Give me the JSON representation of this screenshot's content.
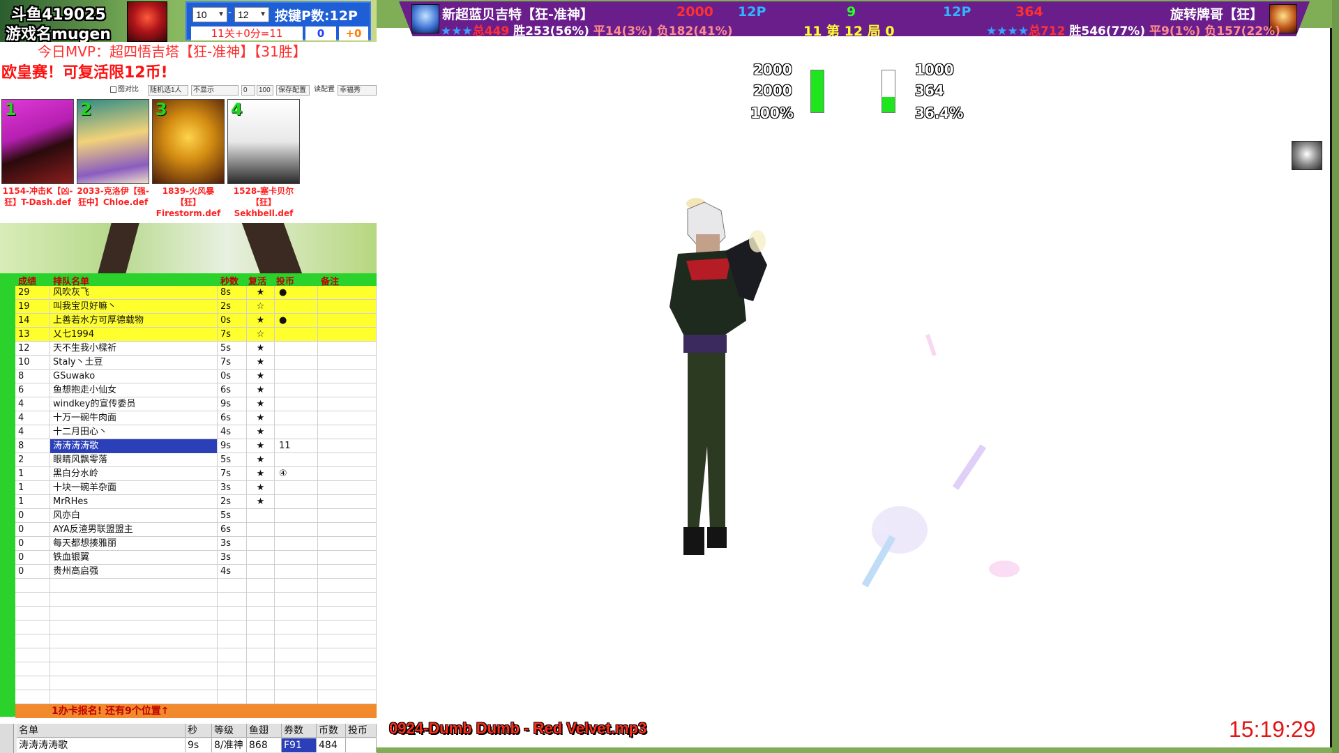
{
  "header": {
    "room_id": "斗鱼419025",
    "game_name": "游戏名mugen",
    "select_a": "10",
    "select_b": "12",
    "keypress_label": "按键P数:12P",
    "level_info": "11关+0分=11",
    "score_a": "0",
    "score_b": "+0"
  },
  "mvp_text": "今日MVP：超四悟吉塔【狂-准神】【31胜】",
  "promo_text": "欧皇赛！可复活限12币!",
  "options": {
    "compare_label": "图对比",
    "random_select": "随机选1人",
    "display_select": "不显示",
    "num_a": "0",
    "num_b": "100",
    "save_button": "保存配置",
    "read_label": "读配置",
    "mode_select": "幸福秀"
  },
  "cards": [
    {
      "num": "1",
      "caption": "1154-冲击K【凶-狂】T-Dash.def"
    },
    {
      "num": "2",
      "caption": "2033-克洛伊【强-狂中】Chloe.def"
    },
    {
      "num": "3",
      "caption": "1839-火风暴【狂】Firestorm.def"
    },
    {
      "num": "4",
      "caption": "1528-塞卡贝尔【狂】Sekhbell.def"
    }
  ],
  "queue": {
    "headers": {
      "score": "成绩",
      "name": "排队名单",
      "sec": "秒数",
      "revive": "复活",
      "coin": "投币",
      "note": "备注"
    },
    "rows": [
      {
        "score": "29",
        "name": "风吹灰飞",
        "sec": "8s",
        "revive": "★",
        "coin": "●",
        "note": "",
        "hl": "yellow"
      },
      {
        "score": "19",
        "name": "叫我宝贝好嘛丶",
        "sec": "2s",
        "revive": "☆",
        "coin": "",
        "note": "",
        "hl": "yellow"
      },
      {
        "score": "14",
        "name": "上善若水方可厚德载物",
        "sec": "0s",
        "revive": "★",
        "coin": "●",
        "note": "",
        "hl": "yellow"
      },
      {
        "score": "13",
        "name": "乂七1994",
        "sec": "7s",
        "revive": "☆",
        "coin": "",
        "note": "",
        "hl": "yellow"
      },
      {
        "score": "12",
        "name": "天不生我小樑祈",
        "sec": "5s",
        "revive": "★",
        "coin": "",
        "note": "",
        "hl": ""
      },
      {
        "score": "10",
        "name": "Staly丶土豆",
        "sec": "7s",
        "revive": "★",
        "coin": "",
        "note": "",
        "hl": ""
      },
      {
        "score": "8",
        "name": "GSuwako",
        "sec": "0s",
        "revive": "★",
        "coin": "",
        "note": "",
        "hl": ""
      },
      {
        "score": "6",
        "name": "鱼想抱走小仙女",
        "sec": "6s",
        "revive": "★",
        "coin": "",
        "note": "",
        "hl": ""
      },
      {
        "score": "4",
        "name": "windkey的宣传委员",
        "sec": "9s",
        "revive": "★",
        "coin": "",
        "note": "",
        "hl": ""
      },
      {
        "score": "4",
        "name": "十万一碗牛肉面",
        "sec": "6s",
        "revive": "★",
        "coin": "",
        "note": "",
        "hl": ""
      },
      {
        "score": "4",
        "name": "十二月田心丶",
        "sec": "4s",
        "revive": "★",
        "coin": "",
        "note": "",
        "hl": ""
      },
      {
        "score": "8",
        "name": "涛涛涛涛歌",
        "sec": "9s",
        "revive": "★",
        "coin": "11",
        "note": "",
        "hl": "selected"
      },
      {
        "score": "2",
        "name": "眼睛风飘零落",
        "sec": "5s",
        "revive": "★",
        "coin": "",
        "note": "",
        "hl": ""
      },
      {
        "score": "1",
        "name": "黑白分水岭",
        "sec": "7s",
        "revive": "★",
        "coin": "④",
        "note": "",
        "hl": ""
      },
      {
        "score": "1",
        "name": "十块一碗羊杂面",
        "sec": "3s",
        "revive": "★",
        "coin": "",
        "note": "",
        "hl": ""
      },
      {
        "score": "1",
        "name": "MrRHes",
        "sec": "2s",
        "revive": "★",
        "coin": "",
        "note": "",
        "hl": ""
      },
      {
        "score": "0",
        "name": "风亦白",
        "sec": "5s",
        "revive": "",
        "coin": "",
        "note": "",
        "hl": ""
      },
      {
        "score": "0",
        "name": "AYA反渣男联盟盟主",
        "sec": "6s",
        "revive": "",
        "coin": "",
        "note": "",
        "hl": ""
      },
      {
        "score": "0",
        "name": "每天都想揍雅丽",
        "sec": "3s",
        "revive": "",
        "coin": "",
        "note": "",
        "hl": ""
      },
      {
        "score": "0",
        "name": "铁血银翼",
        "sec": "3s",
        "revive": "",
        "coin": "",
        "note": "",
        "hl": ""
      },
      {
        "score": "0",
        "name": "贵州高启强",
        "sec": "4s",
        "revive": "",
        "coin": "",
        "note": "",
        "hl": ""
      }
    ],
    "signup": "1办卡报名! 还有9个位置↑"
  },
  "bottom_table": {
    "headers": [
      "名单",
      "秒",
      "等级",
      "鱼翅",
      "券数",
      "币数",
      "投币"
    ],
    "values": [
      "涛涛涛涛歌",
      "9s",
      "8/准神",
      "868",
      "F91",
      "484",
      ""
    ]
  },
  "match": {
    "p1_name": "新超蓝贝吉特【狂-准神】",
    "p1_hp": "2000",
    "p1_side": "12P",
    "center_num": "9",
    "p2_side": "12P",
    "p2_hp": "364",
    "p2_name": "旋转牌哥【狂】",
    "p1_stars": "★★★",
    "p1_total": "总449",
    "p1_win": "胜253(56%)",
    "p1_draw": "平14(3%)",
    "p1_loss": "负182(41%)",
    "round_info": "11 第 12 局 0",
    "p2_stars": "★★★★",
    "p2_total": "总712",
    "p2_win": "胜546(77%)",
    "p2_draw": "平9(1%)",
    "p2_loss": "负157(22%)"
  },
  "hp_display": {
    "p1_max": "2000",
    "p1_cur": "2000",
    "p1_pct": "100%",
    "p1_fill": 1.0,
    "p2_max": "1000",
    "p2_cur": "364",
    "p2_pct": "36.4%",
    "p2_fill": 0.364
  },
  "music": "0924-Dumb Dumb - Red Velvet.mp3",
  "clock": "15:19:29"
}
